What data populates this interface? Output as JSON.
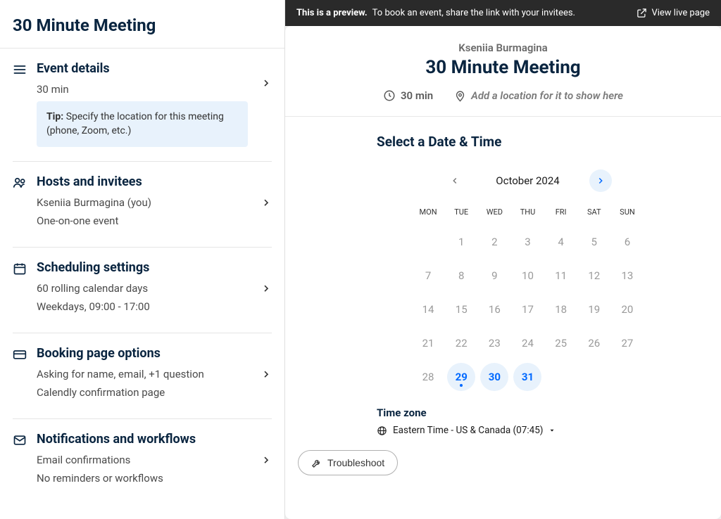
{
  "page_title": "30 Minute Meeting",
  "sections": {
    "event_details": {
      "title": "Event details",
      "duration": "30 min",
      "tip_label": "Tip:",
      "tip_text": "Specify the location for this meeting (phone, Zoom, etc.)"
    },
    "hosts": {
      "title": "Hosts and invitees",
      "host": "Kseniia Burmagina (you)",
      "type": "One-on-one event"
    },
    "scheduling": {
      "title": "Scheduling settings",
      "window": "60 rolling calendar days",
      "hours": "Weekdays, 09:00 - 17:00"
    },
    "booking": {
      "title": "Booking page options",
      "questions": "Asking for name, email, +1 question",
      "confirmation": "Calendly confirmation page"
    },
    "notifications": {
      "title": "Notifications and workflows",
      "emails": "Email confirmations",
      "reminders": "No reminders or workflows"
    }
  },
  "preview": {
    "banner_bold": "This is a preview.",
    "banner_rest": "To book an event, share the link with your invitees.",
    "view_live": "View live page",
    "host_name": "Kseniia Burmagina",
    "meeting_title": "30 Minute Meeting",
    "duration": "30 min",
    "location_placeholder": "Add a location for it to show here",
    "select_title": "Select a Date & Time",
    "month": "October 2024",
    "dow": [
      "MON",
      "TUE",
      "WED",
      "THU",
      "FRI",
      "SAT",
      "SUN"
    ],
    "days": [
      [
        "1",
        "2",
        "3",
        "4",
        "5",
        "6"
      ],
      [
        "7",
        "8",
        "9",
        "10",
        "11",
        "12",
        "13"
      ],
      [
        "14",
        "15",
        "16",
        "17",
        "18",
        "19",
        "20"
      ],
      [
        "21",
        "22",
        "23",
        "24",
        "25",
        "26",
        "27"
      ],
      [
        "28",
        "29",
        "30",
        "31"
      ]
    ],
    "available_days": [
      29,
      30,
      31
    ],
    "today": 29,
    "tz_label": "Time zone",
    "tz_value": "Eastern Time - US & Canada (07:45)",
    "troubleshoot": "Troubleshoot"
  }
}
